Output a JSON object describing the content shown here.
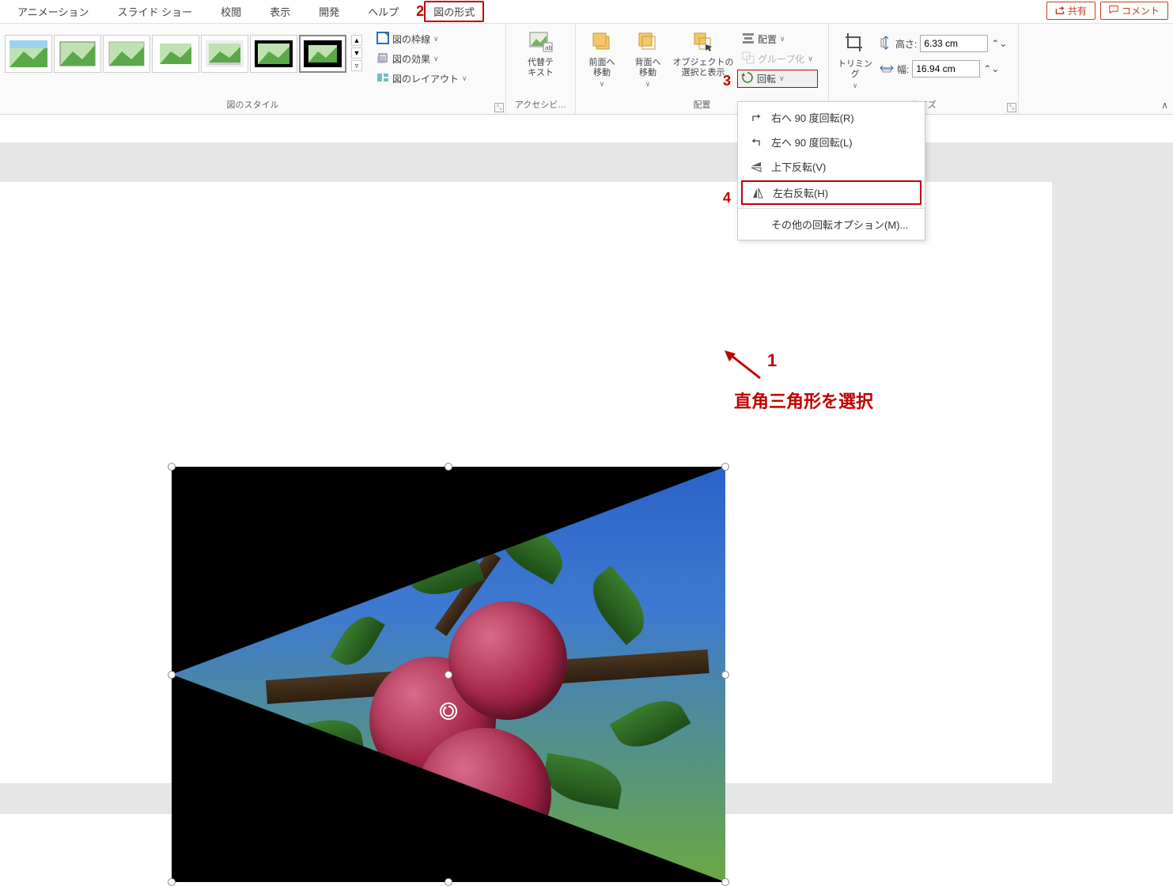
{
  "menu": {
    "tabs": [
      "アニメーション",
      "スライド ショー",
      "校閲",
      "表示",
      "開発",
      "ヘルプ",
      "図の形式"
    ],
    "active_index": 6,
    "share": "共有",
    "comment": "コメント"
  },
  "ribbon": {
    "styles_group_label": "図のスタイル",
    "accessibility_group_label": "アクセシビ…",
    "arrange_group_label": "配置",
    "size_group_label": "サイズ",
    "pic_border": "図の枠線",
    "pic_effects": "図の効果",
    "pic_layout": "図のレイアウト",
    "alt_text": "代替テ\nキスト",
    "bring_forward": "前面へ\n移動",
    "send_backward": "背面へ\n移動",
    "selection_pane": "オブジェクトの\n選択と表示",
    "align": "配置",
    "group": "グループ化",
    "rotate": "回転",
    "crop": "トリミング",
    "height_label": "高さ:",
    "width_label": "幅:",
    "height_value": "6.33 cm",
    "width_value": "16.94 cm"
  },
  "dropdown": {
    "rotate_right": "右へ 90 度回転(R)",
    "rotate_left": "左へ 90 度回転(L)",
    "flip_v": "上下反転(V)",
    "flip_h": "左右反転(H)",
    "more": "その他の回転オプション(M)..."
  },
  "annotations": {
    "n1": "1",
    "n2": "2",
    "n3": "3",
    "n4": "4",
    "select_triangle": "直角三角形を選択"
  }
}
